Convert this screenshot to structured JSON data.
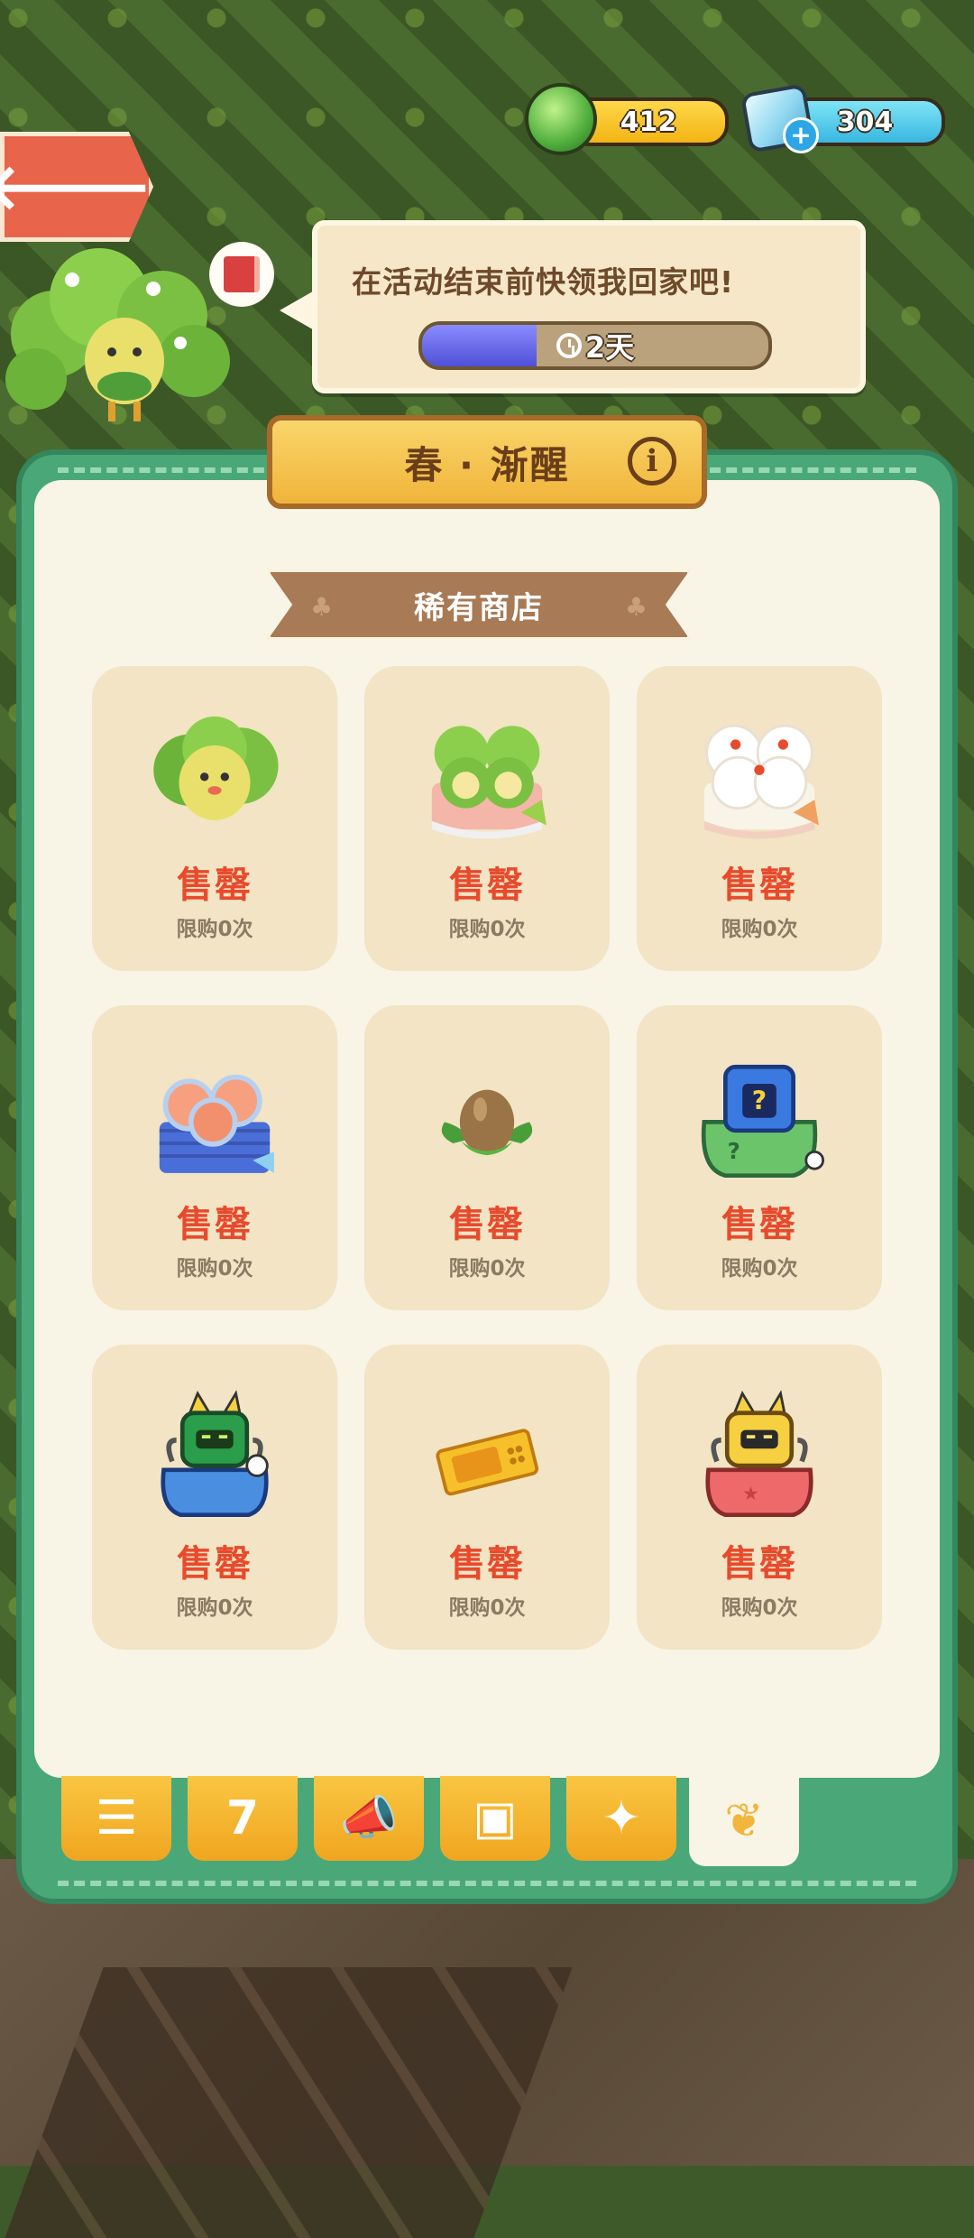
{
  "currency": {
    "coins": "412",
    "gems": "304",
    "gem_plus": "+"
  },
  "back_arrow": "🡐",
  "speech": {
    "message": "在活动结束前快领我回家吧!",
    "timer_label": "2天",
    "timer_progress": 0.33
  },
  "panel": {
    "title": "春 · 渐醒",
    "info_icon": "i",
    "shop_title": "稀有商店"
  },
  "items": [
    {
      "icon": "green-bush-chick",
      "status": "售罄",
      "limit": "限购0次"
    },
    {
      "icon": "green-bush-chick-bundle",
      "status": "售罄",
      "limit": "限购0次"
    },
    {
      "icon": "white-bush-chick-bundle",
      "status": "售罄",
      "limit": "限购0次"
    },
    {
      "icon": "peach-fruit-basket",
      "status": "售罄",
      "limit": "限购0次"
    },
    {
      "icon": "hazelnut",
      "status": "售罄",
      "limit": "限购0次"
    },
    {
      "icon": "mystery-gift-bag",
      "status": "售罄",
      "limit": "限购0次"
    },
    {
      "icon": "blue-robot-cat-bag",
      "status": "售罄",
      "limit": "限购0次"
    },
    {
      "icon": "golden-ticket",
      "status": "售罄",
      "limit": "限购0次"
    },
    {
      "icon": "red-robot-cat-bag",
      "status": "售罄",
      "limit": "限购0次"
    }
  ],
  "tabs": [
    {
      "icon": "list-icon",
      "glyph": "☰"
    },
    {
      "icon": "calendar-icon",
      "glyph": "7"
    },
    {
      "icon": "megaphone-icon",
      "glyph": "📣"
    },
    {
      "icon": "cards-icon",
      "glyph": "▣"
    },
    {
      "icon": "gift-icon",
      "glyph": "✦"
    },
    {
      "icon": "leaf-icon",
      "glyph": "❦"
    }
  ],
  "colors": {
    "panel_green": "#4aa878",
    "sold_out_red": "#e84a2c",
    "card_beige": "#f2e4c4",
    "tab_orange": "#f0a520"
  }
}
